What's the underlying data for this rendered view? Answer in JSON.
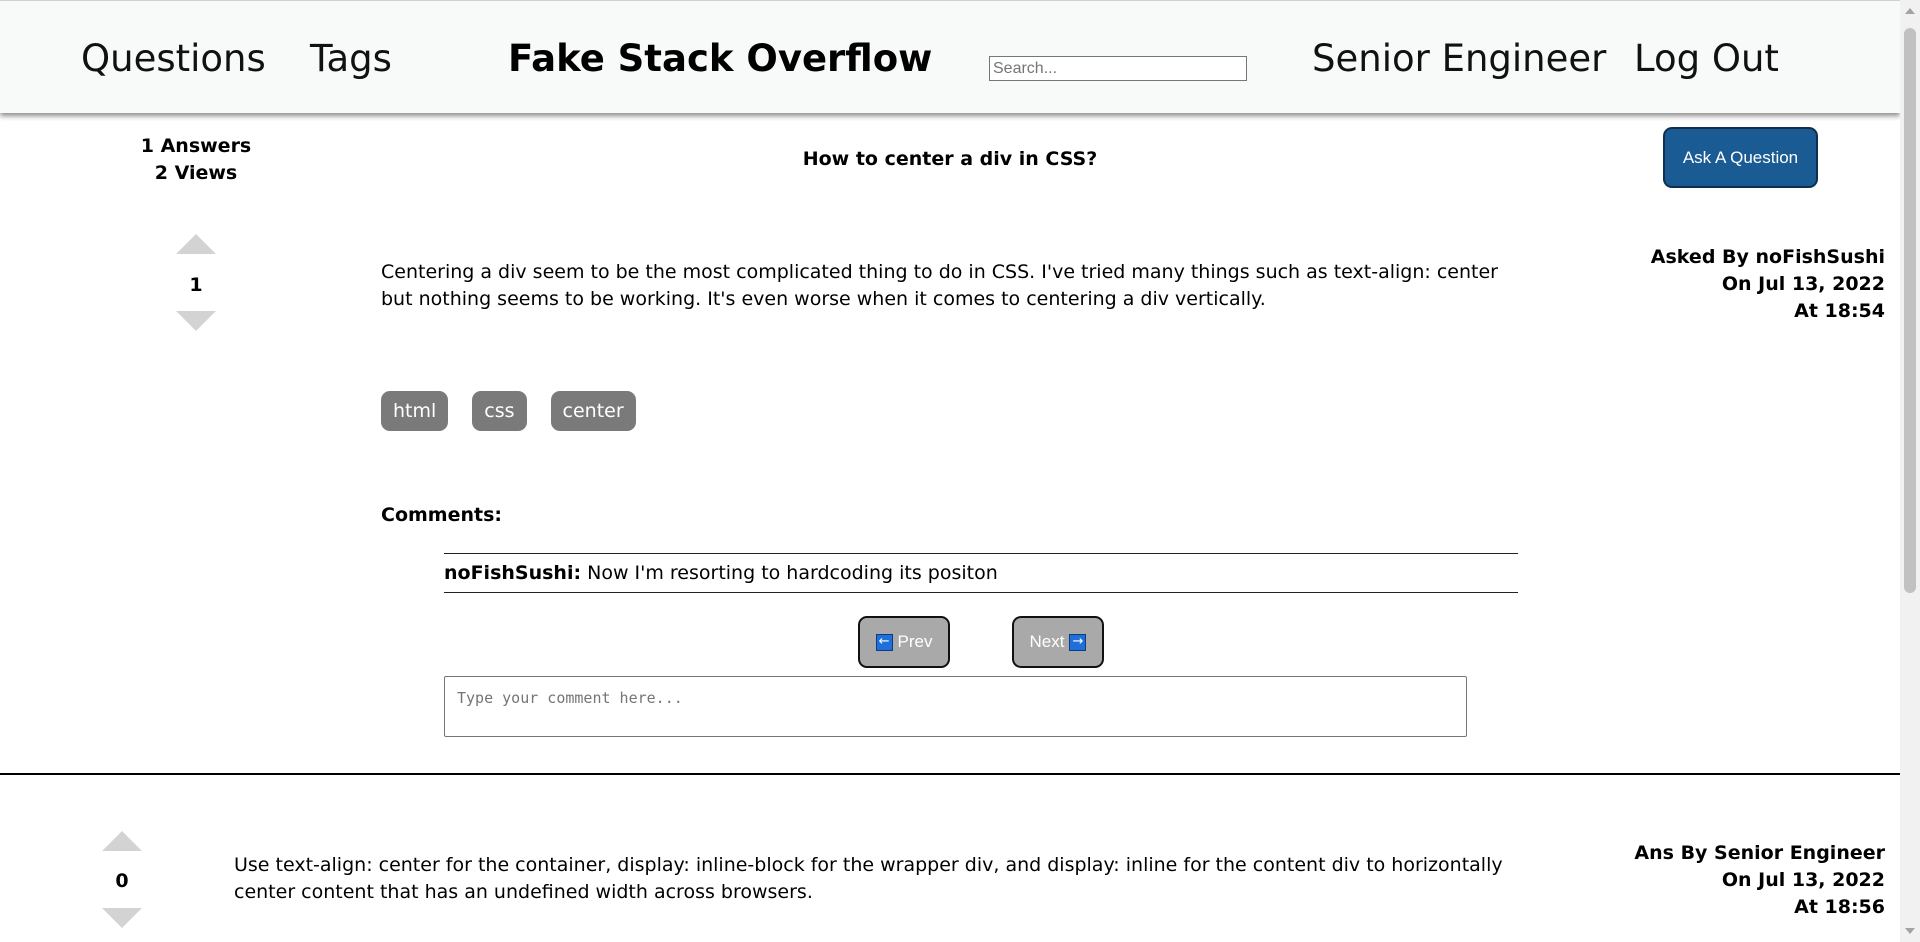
{
  "header": {
    "nav_questions": "Questions",
    "nav_tags": "Tags",
    "site_title": "Fake Stack Overflow",
    "search_placeholder": "Search...",
    "user_name": "Senior Engineer",
    "logout": "Log Out"
  },
  "question": {
    "answers_count": "1 Answers",
    "views_count": "2 Views",
    "title": "How to center a div in CSS?",
    "ask_button": "Ask A Question",
    "votes": "1",
    "body": "Centering a div seem to be the most complicated thing to do in CSS. I've tried many things such as text-align: center but nothing seems to be working. It's even worse when it comes to centering a div vertically.",
    "asked_by": "Asked By noFishSushi",
    "asked_on": "On Jul 13, 2022",
    "asked_at": "At 18:54",
    "tags": [
      "html",
      "css",
      "center"
    ],
    "comments_label": "Comments:",
    "comments": [
      {
        "author": "noFishSushi:",
        "text": " Now I'm resorting to hardcoding its positon"
      }
    ],
    "prev_label": "Prev",
    "next_label": "Next",
    "comment_placeholder": "Type your comment here..."
  },
  "answer": {
    "votes": "0",
    "body": "Use text-align: center for the container, display: inline-block for the wrapper div, and display: inline for the content div to horizontally center content that has an undefined width across browsers.",
    "ans_by": "Ans By Senior Engineer",
    "ans_on": "On Jul 13, 2022",
    "ans_at": "At 18:56"
  },
  "colors": {
    "ask_button": "#1a5b93",
    "tag": "#7a7a7a",
    "pager_button": "#a9a9a9",
    "vote_arrow": "#d3d3d3",
    "header_bg": "#f8f9f9"
  },
  "icons": {
    "vote_up": "triangle-up-icon",
    "vote_down": "triangle-down-icon",
    "prev": "arrow-left-icon",
    "next": "arrow-right-icon"
  }
}
